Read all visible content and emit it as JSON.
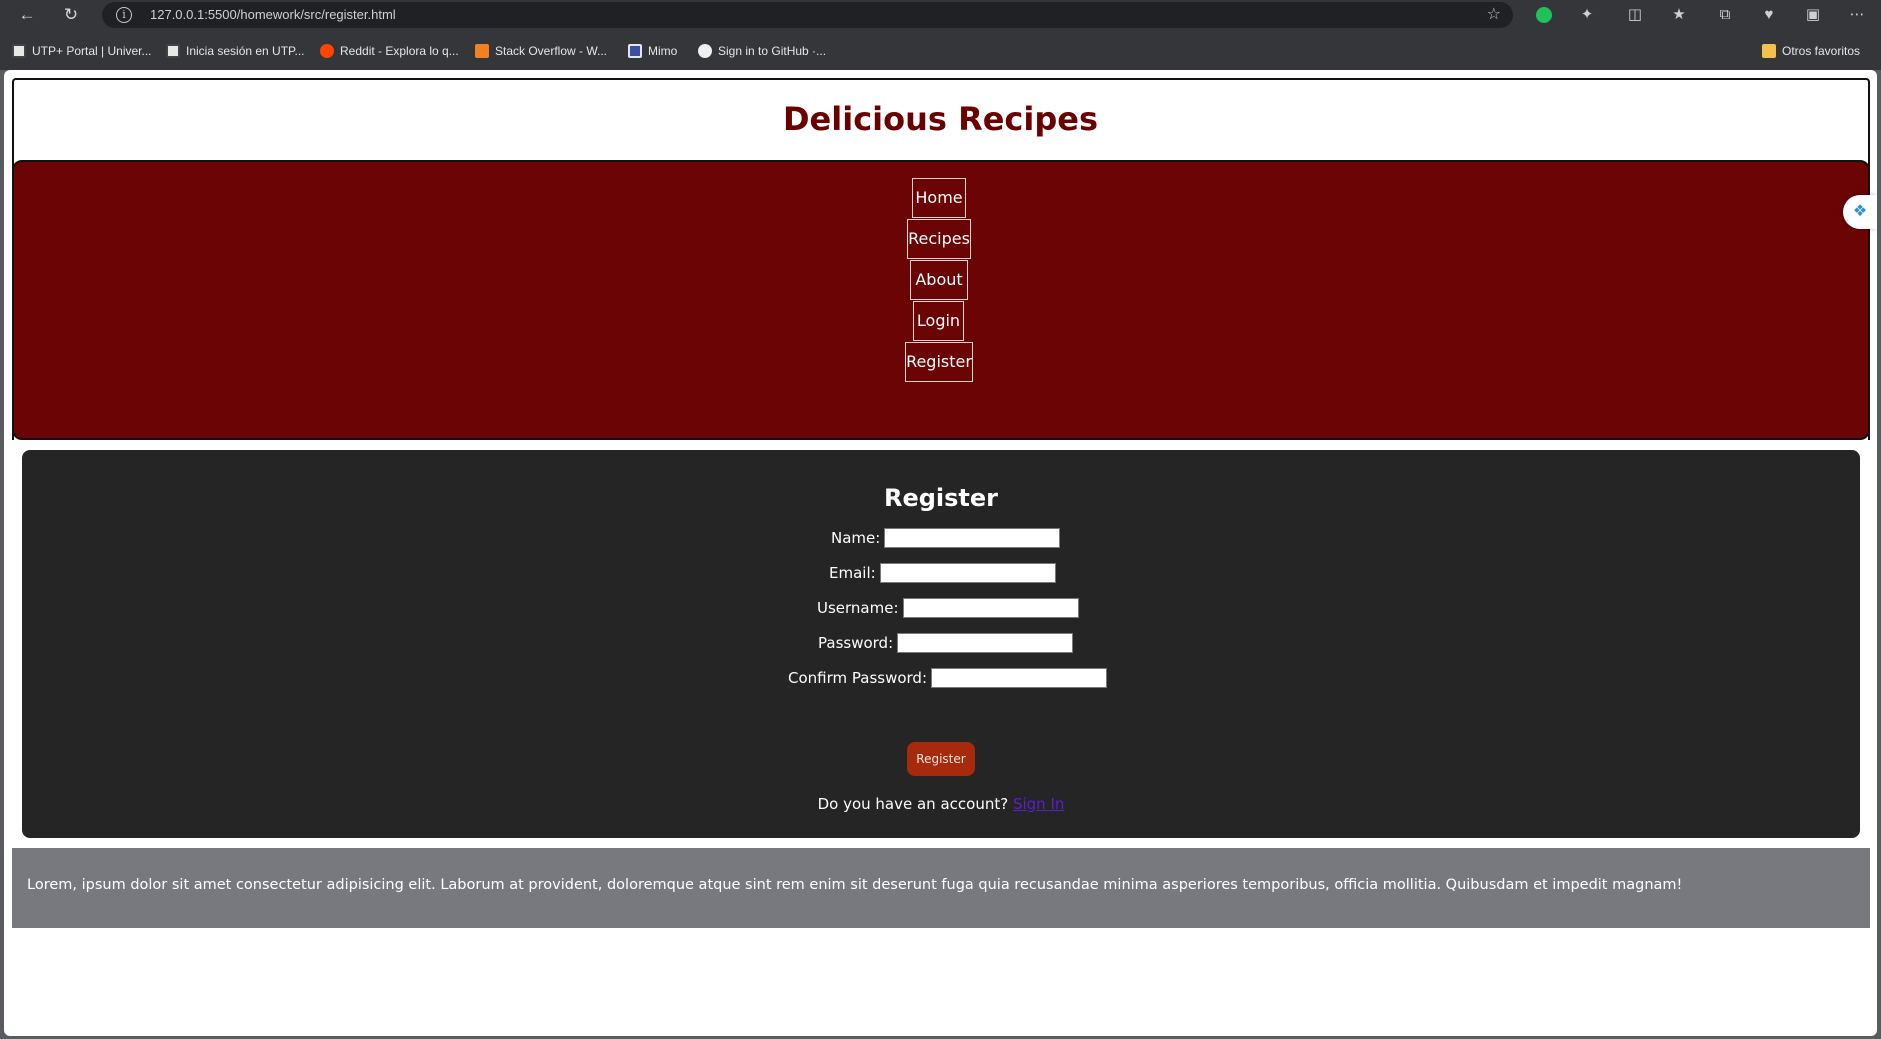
{
  "browser": {
    "url": "127.0.0.1:5500/homework/src/register.html",
    "bookmarks": [
      {
        "label": "UTP+ Portal | Univer...",
        "icon": "utp-icon"
      },
      {
        "label": "Inicia sesión en UTP...",
        "icon": "utp-icon"
      },
      {
        "label": "Reddit - Explora lo q...",
        "icon": "reddit-icon"
      },
      {
        "label": "Stack Overflow - W...",
        "icon": "stackoverflow-icon"
      },
      {
        "label": "Mimo",
        "icon": "mimo-icon"
      },
      {
        "label": "Sign in to GitHub ·...",
        "icon": "github-icon"
      }
    ],
    "other_bookmarks": "Otros favoritos"
  },
  "site": {
    "title": "Delicious Recipes",
    "nav": [
      "Home",
      "Recipes",
      "About",
      "Login",
      "Register"
    ]
  },
  "form": {
    "title": "Register",
    "fields": [
      "Name:",
      "Email:",
      "Username:",
      "Password:",
      "Confirm Password:"
    ],
    "submit_label": "Register",
    "account_text": "Do you have an account?",
    "sign_in_label": "Sign In"
  },
  "footer": {
    "text": "Lorem, ipsum dolor sit amet consectetur adipisicing elit. Laborum at provident, doloremque atque sint rem enim sit deserunt fuga quia recusandae minima asperiores temporibus, officia mollitia. Quibusdam et impedit magnam!"
  },
  "colors": {
    "brand": "#6b0000",
    "nav_background": "#6b0404",
    "form_background": "#252525",
    "submit_background": "#a82a0c",
    "footer_background": "#78797f"
  }
}
